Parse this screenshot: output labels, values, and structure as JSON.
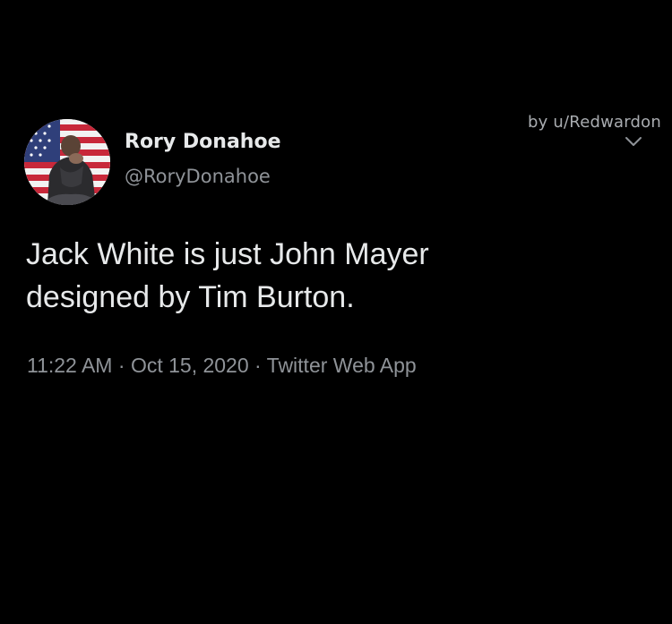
{
  "credit": "by u/Redwardon",
  "tweet": {
    "author_name": "Rory Donahoe",
    "author_handle": "@RoryDonahoe",
    "text_line1": "Jack White is just John Mayer",
    "text_line2": "designed by Tim Burton.",
    "time": "11:22 AM",
    "date": "Oct 15, 2020",
    "source": "Twitter Web App",
    "separator": " · "
  },
  "icons": {
    "avatar": "avatar",
    "more": "chevron-down-icon"
  },
  "colors": {
    "background": "#000000",
    "primary_text": "#e7e9ea",
    "secondary_text": "#8f9398"
  }
}
